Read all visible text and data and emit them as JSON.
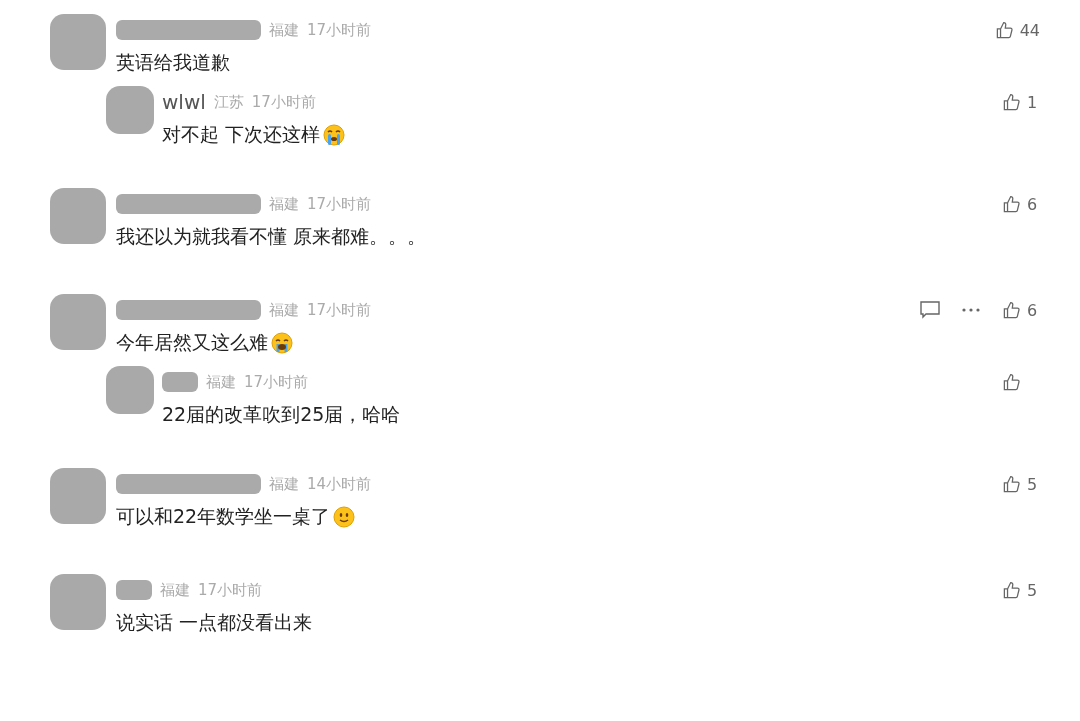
{
  "comments": [
    {
      "author": {
        "kind": "blur"
      },
      "location": "福建",
      "time": "17小时前",
      "text": "英语给我道歉",
      "hovered": false,
      "likes": "44",
      "replies": [
        {
          "author": {
            "kind": "text",
            "name": "wlwl"
          },
          "location": "江苏",
          "time": "17小时前",
          "text": "对不起 下次还这样",
          "emoji": {
            "kind": "tears"
          },
          "hovered": false,
          "likes": "1"
        }
      ]
    },
    {
      "author": {
        "kind": "blur"
      },
      "location": "福建",
      "time": "17小时前",
      "text": "我还以为就我看不懂 原来都难。。。",
      "hovered": false,
      "likes": "6"
    },
    {
      "author": {
        "kind": "blur"
      },
      "location": "福建",
      "time": "17小时前",
      "text": "今年居然又这么难",
      "emoji": {
        "kind": "cry"
      },
      "hovered": true,
      "likes": "6",
      "replies": [
        {
          "author": {
            "kind": "chip"
          },
          "location": "福建",
          "time": "17小时前",
          "text": "22届的改革吹到25届，哈哈",
          "hovered": false
        }
      ]
    },
    {
      "author": {
        "kind": "blur"
      },
      "location": "福建",
      "time": "14小时前",
      "text": "可以和22年数学坐一桌了",
      "emoji": {
        "kind": "smile"
      },
      "hovered": false,
      "likes": "5"
    },
    {
      "author": {
        "kind": "chip"
      },
      "location": "福建",
      "time": "17小时前",
      "text": "说实话 一点都没看出来",
      "hovered": false,
      "likes": "5"
    }
  ]
}
